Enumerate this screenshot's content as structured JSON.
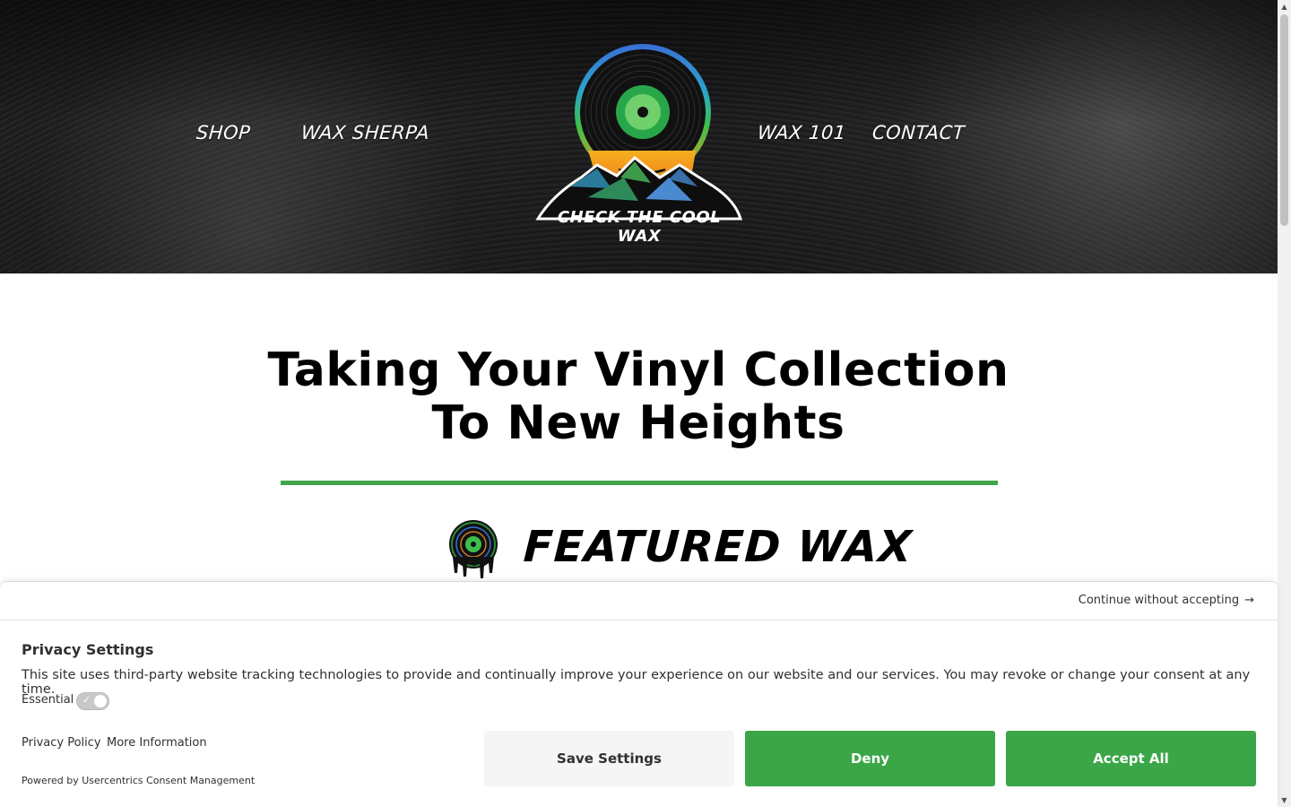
{
  "header": {
    "nav_left": [
      "SHOP",
      "WAX SHERPA"
    ],
    "nav_right": [
      "WAX 101",
      "CONTACT"
    ],
    "logo_text": "CHECK THE COOL WAX"
  },
  "main": {
    "headline_line1": "Taking Your Vinyl Collection",
    "headline_line2": "To New Heights",
    "featured_title": "FEATURED WAX",
    "accent_color": "#3fa54a"
  },
  "consent": {
    "continue_label": "Continue without accepting",
    "title": "Privacy Settings",
    "description": "This site uses third-party website tracking technologies to provide and continually improve your experience on our website and our services. You may revoke or change your consent at any time.",
    "essential_label": "Essential",
    "privacy_policy_label": "Privacy Policy",
    "more_info_label": "More Information",
    "powered_by": "Powered by Usercentrics Consent Management",
    "save_label": "Save Settings",
    "deny_label": "Deny",
    "accept_label": "Accept All",
    "button_color": "#3ba647"
  }
}
